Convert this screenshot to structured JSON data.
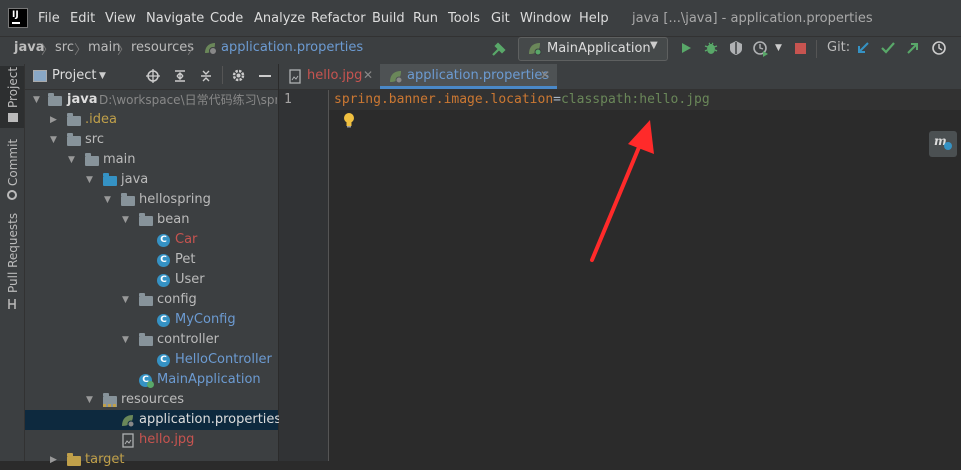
{
  "menu": {
    "items": [
      "File",
      "Edit",
      "View",
      "Navigate",
      "Code",
      "Analyze",
      "Refactor",
      "Build",
      "Run",
      "Tools",
      "Git",
      "Window",
      "Help"
    ],
    "window_title": "java [...\\java] - application.properties"
  },
  "breadcrumb": [
    "java",
    "src",
    "main",
    "resources",
    "application.properties"
  ],
  "toolbar": {
    "run_config": "MainApplication",
    "git_label": "Git:"
  },
  "tool_strip": {
    "project": "Project",
    "commit": "Commit",
    "pull_requests": "Pull Requests"
  },
  "project_panel": {
    "title": "Project",
    "tree": [
      {
        "label": "java",
        "extra": "D:\\workspace\\日常代码练习\\spr",
        "type": "module"
      },
      {
        "label": ".idea",
        "type": "folder"
      },
      {
        "label": "src",
        "type": "folder"
      },
      {
        "label": "main",
        "type": "folder"
      },
      {
        "label": "java",
        "type": "folder"
      },
      {
        "label": "hellospring",
        "type": "package"
      },
      {
        "label": "bean",
        "type": "package"
      },
      {
        "label": "Car",
        "type": "class"
      },
      {
        "label": "Pet",
        "type": "class"
      },
      {
        "label": "User",
        "type": "class"
      },
      {
        "label": "config",
        "type": "package"
      },
      {
        "label": "MyConfig",
        "type": "class"
      },
      {
        "label": "controller",
        "type": "package"
      },
      {
        "label": "HelloController",
        "type": "class"
      },
      {
        "label": "MainApplication",
        "type": "spring-class"
      },
      {
        "label": "resources",
        "type": "folder"
      },
      {
        "label": "application.properties",
        "type": "properties"
      },
      {
        "label": "hello.jpg",
        "type": "image"
      },
      {
        "label": "target",
        "type": "folder"
      }
    ]
  },
  "editor": {
    "tabs": [
      {
        "label": "hello.jpg",
        "active": false
      },
      {
        "label": "application.properties",
        "active": true
      }
    ],
    "line_number": "1",
    "code": {
      "key": "spring.banner.image.location",
      "eq": "=",
      "value": "classpath:hello.jpg"
    }
  },
  "colors": {
    "accent": "#4a88c7",
    "class_icon": "#3592c4",
    "run_green": "#59a869",
    "stop_red": "#c75450",
    "annotation_arrow": "#ff2a2a"
  }
}
